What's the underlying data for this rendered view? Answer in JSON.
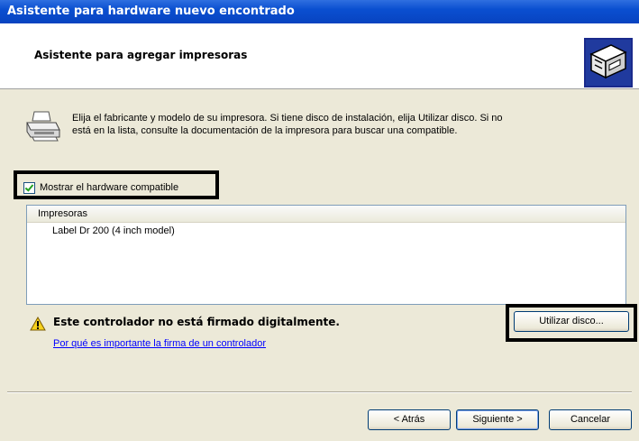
{
  "window": {
    "title": "Asistente para hardware nuevo encontrado"
  },
  "header": {
    "title": "Asistente para agregar impresoras",
    "icon": "hardware-wizard-icon"
  },
  "instructions": {
    "icon": "printer-icon",
    "line1": "Elija el fabricante y modelo de su impresora. Si tiene disco de instalación, elija Utilizar disco. Si no",
    "line2": "está en la lista, consulte la documentación de la impresora para buscar una compatible."
  },
  "compatible_checkbox": {
    "label": "Mostrar el hardware compatible",
    "checked": true
  },
  "printer_list": {
    "column_header": "Impresoras",
    "items": [
      "Label Dr 200 (4 inch model)"
    ]
  },
  "warning": {
    "icon": "warning-icon",
    "text": "Este controlador no está firmado digitalmente.",
    "link": "Por qué es importante la firma de un controlador"
  },
  "buttons": {
    "have_disk": "Utilizar disco...",
    "back": "< Atrás",
    "next": "Siguiente >",
    "cancel": "Cancelar"
  },
  "colors": {
    "titlebar": "#0a4fd0",
    "dialog_bg": "#ece9d8",
    "link": "#0000ff",
    "highlight_box": "#000000"
  }
}
